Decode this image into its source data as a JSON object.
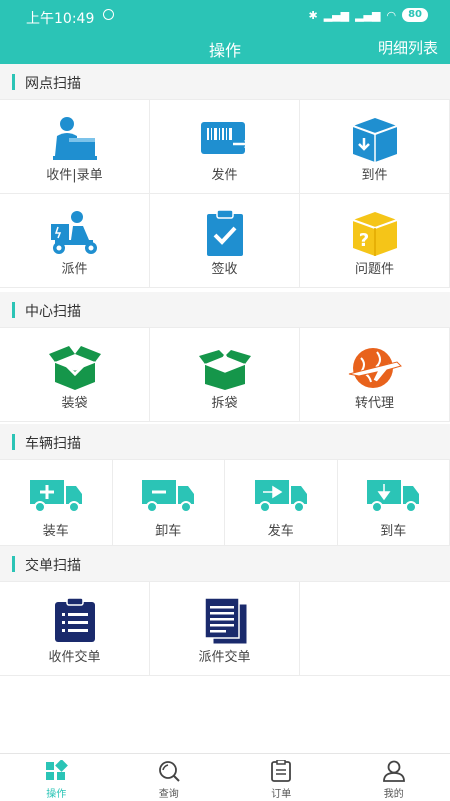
{
  "status_bar": {
    "time": "上午10:49",
    "battery": "80"
  },
  "nav": {
    "title": "操作",
    "right": "明细列表"
  },
  "sections": [
    {
      "title": "网点扫描",
      "items": [
        {
          "label": "收件|录单",
          "icon": "courier-package-icon"
        },
        {
          "label": "发件",
          "icon": "barcode-send-icon"
        },
        {
          "label": "到件",
          "icon": "box-arrive-icon"
        },
        {
          "label": "派件",
          "icon": "scooter-delivery-icon"
        },
        {
          "label": "签收",
          "icon": "clipboard-check-icon"
        },
        {
          "label": "问题件",
          "icon": "question-box-icon"
        }
      ]
    },
    {
      "title": "中心扫描",
      "items": [
        {
          "label": "装袋",
          "icon": "box-pack-icon"
        },
        {
          "label": "拆袋",
          "icon": "box-unpack-icon"
        },
        {
          "label": "转代理",
          "icon": "globe-plane-icon"
        }
      ]
    },
    {
      "title": "车辆扫描",
      "items": [
        {
          "label": "装车",
          "icon": "truck-load-icon"
        },
        {
          "label": "卸车",
          "icon": "truck-unload-icon"
        },
        {
          "label": "发车",
          "icon": "truck-depart-icon"
        },
        {
          "label": "到车",
          "icon": "truck-arrive-icon"
        }
      ]
    },
    {
      "title": "交单扫描",
      "items": [
        {
          "label": "收件交单",
          "icon": "receive-handover-icon"
        },
        {
          "label": "派件交单",
          "icon": "dispatch-handover-icon"
        }
      ]
    }
  ],
  "tabs": [
    {
      "label": "操作",
      "icon": "grid-icon",
      "active": true
    },
    {
      "label": "查询",
      "icon": "search-icon",
      "active": false
    },
    {
      "label": "订单",
      "icon": "order-list-icon",
      "active": false
    },
    {
      "label": "我的",
      "icon": "user-icon",
      "active": false
    }
  ],
  "colors": {
    "accent": "#2bc4b6",
    "blue": "#1f8fd0",
    "green": "#15964a",
    "orange": "#e8621c",
    "navy": "#1a2a6c",
    "yellow": "#f5c518"
  }
}
